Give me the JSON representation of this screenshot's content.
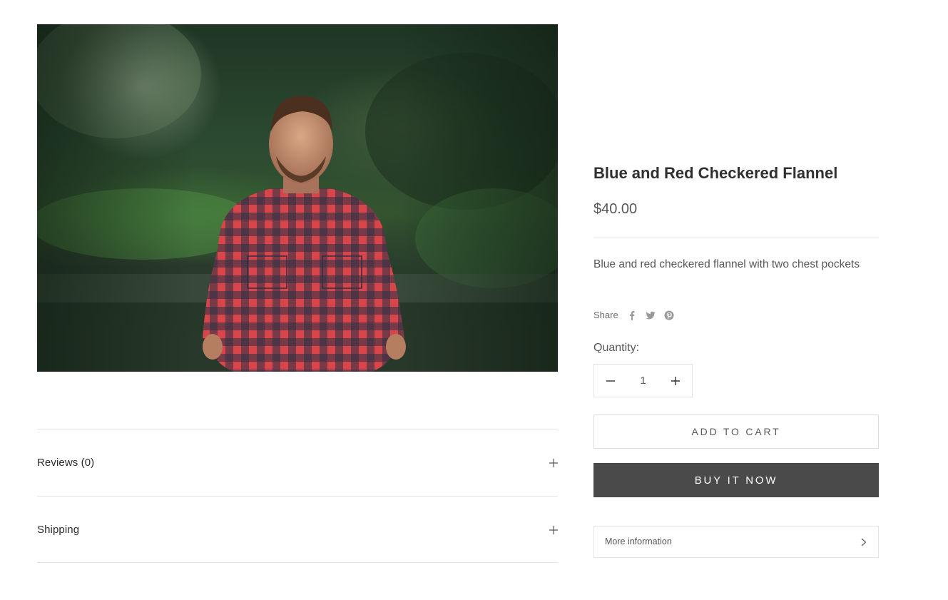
{
  "product": {
    "image_alt": "Man wearing a red and navy checkered flannel shirt in a forest",
    "title": "Blue and Red Checkered Flannel",
    "price": "$40.00",
    "description": "Blue and red checkered flannel with two chest pockets"
  },
  "share": {
    "label": "Share",
    "icons": [
      "facebook-icon",
      "twitter-icon",
      "pinterest-icon"
    ]
  },
  "quantity": {
    "label": "Quantity:",
    "value": "1"
  },
  "buttons": {
    "add_to_cart": "ADD TO CART",
    "buy_now": "BUY IT NOW"
  },
  "more_info": {
    "label": "More information"
  },
  "accordions": {
    "reviews": "Reviews (0)",
    "shipping": "Shipping"
  },
  "colors": {
    "text": "#1c1b1b",
    "muted": "#585858",
    "border": "#e3e3e3",
    "buy_button_bg": "#4a4a4a"
  }
}
